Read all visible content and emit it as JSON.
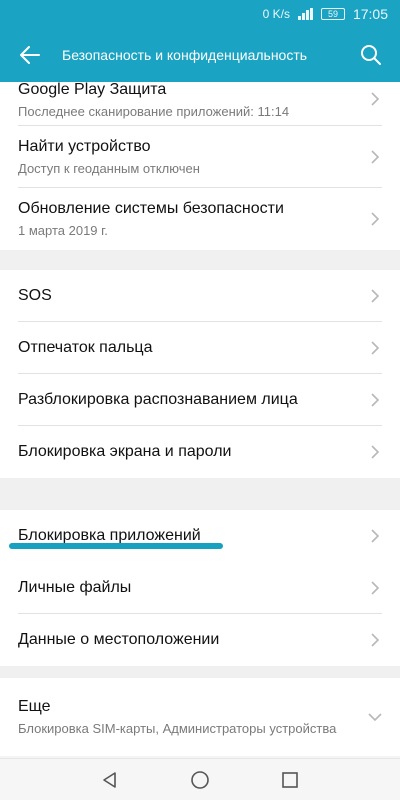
{
  "status_bar": {
    "net_speed": "0 K/s",
    "battery_level": "59",
    "time": "17:05"
  },
  "appbar": {
    "title": "Безопасность и конфиденциальность",
    "back_icon": "arrow-left-icon",
    "search_icon": "search-icon"
  },
  "groups": [
    {
      "items": [
        {
          "title": "Google Play Защита",
          "subtitle": "Последнее сканирование приложений: 11:14"
        },
        {
          "title": "Найти устройство",
          "subtitle": "Доступ к геоданным отключен"
        },
        {
          "title": "Обновление системы безопасности",
          "subtitle": "1 марта 2019 г."
        }
      ]
    },
    {
      "items": [
        {
          "title": "SOS"
        },
        {
          "title": "Отпечаток пальца"
        },
        {
          "title": "Разблокировка распознаванием лица"
        },
        {
          "title": "Блокировка экрана и пароли"
        }
      ]
    },
    {
      "items": [
        {
          "title": "Блокировка приложений"
        },
        {
          "title": "Личные файлы"
        },
        {
          "title": "Данные о местоположении"
        }
      ]
    },
    {
      "items": [
        {
          "title": "Еще",
          "subtitle": "Блокировка SIM-карты, Администраторы устройства"
        }
      ]
    }
  ],
  "colors": {
    "accent": "#1aa3c2",
    "highlight": "#17a0c0"
  },
  "navbar": {
    "back_icon": "nav-back-triangle-icon",
    "home_icon": "nav-home-circle-icon",
    "recents_icon": "nav-recents-square-icon"
  }
}
